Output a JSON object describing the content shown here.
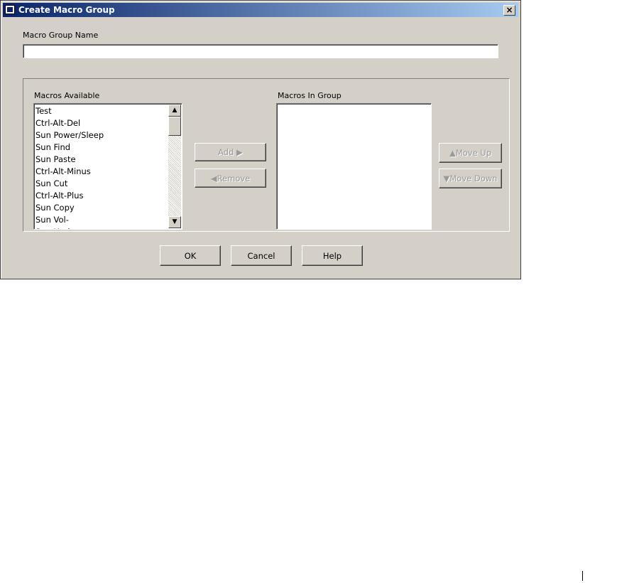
{
  "window": {
    "title": "Create Macro Group",
    "close_glyph": "×"
  },
  "form": {
    "name_label": "Macro Group Name",
    "name_value": ""
  },
  "available": {
    "label": "Macros Available",
    "items": [
      "Test",
      "Ctrl-Alt-Del",
      "Sun Power/Sleep",
      "Sun Find",
      "Sun Paste",
      "Ctrl-Alt-Minus",
      "Sun Cut",
      "Ctrl-Alt-Plus",
      "Sun Copy",
      "Sun Vol-",
      "Sun Undo"
    ]
  },
  "in_group": {
    "label": "Macros In Group",
    "items": []
  },
  "transfer": {
    "add_label": "Add ▶",
    "remove_label": "◀Remove"
  },
  "order": {
    "move_up_label": "▲Move Up",
    "move_down_label": "▼Move Down"
  },
  "footer": {
    "ok_label": "OK",
    "cancel_label": "Cancel",
    "help_label": "Help"
  },
  "scroll_arrows": {
    "up": "▲",
    "down": "▼"
  },
  "icons": {
    "title": "window-icon",
    "close": "close-icon",
    "scroll_up": "arrow-up-icon",
    "scroll_down": "arrow-down-icon"
  },
  "colors": {
    "dialog_bg": "#d4d0c8",
    "titlebar_start": "#0a246a",
    "titlebar_end": "#a6caf0",
    "disabled_text": "#9a9a9a"
  }
}
